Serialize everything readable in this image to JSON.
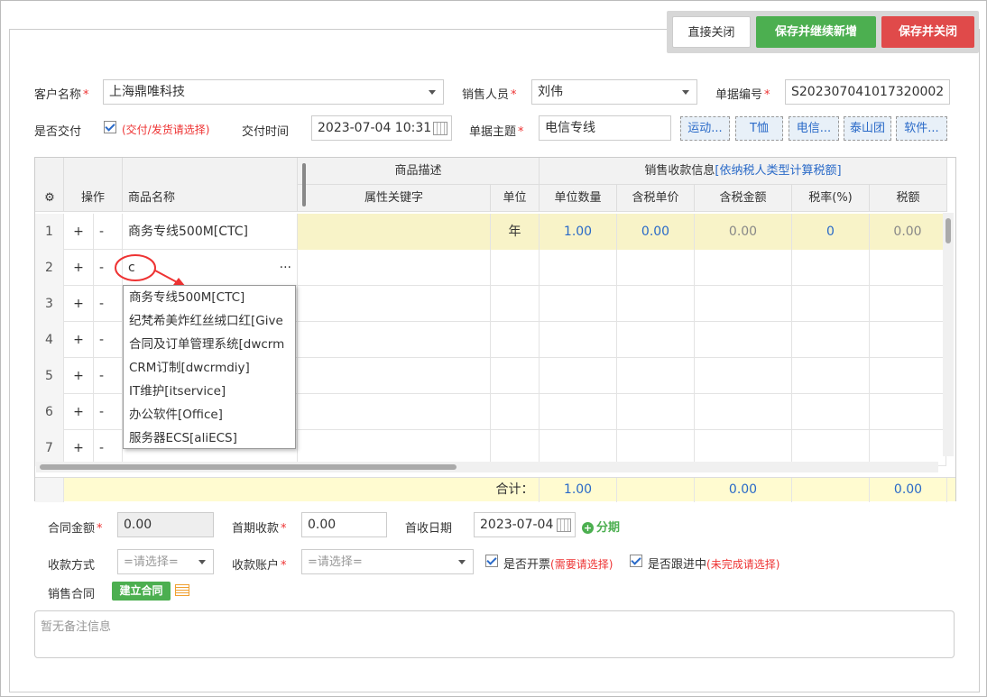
{
  "toolbar": {
    "close_label": "直接关闭",
    "save_new_label": "保存并继续新增",
    "save_close_label": "保存并关闭"
  },
  "form": {
    "customer_label": "客户名称",
    "customer_value": "上海鼎唯科技",
    "sales_label": "销售人员",
    "sales_value": "刘伟",
    "docno_label": "单据编号",
    "docno_value": "S202307041017320002",
    "delivered_label": "是否交付",
    "delivered_hint": "(交付/发货请选择)",
    "delivery_time_label": "交付时间",
    "delivery_time_value": "2023-07-04 10:31",
    "subject_label": "单据主题",
    "subject_value": "电信专线",
    "tags": [
      "运动...",
      "T恤",
      "电信...",
      "泰山团",
      "软件..."
    ]
  },
  "grid": {
    "group_desc": "商品描述",
    "group_sales": "销售收款信息",
    "group_sales_link": "[依纳税人类型计算税额]",
    "columns": [
      "操作",
      "商品名称",
      "属性关键字",
      "单位",
      "单位数量",
      "含税单价",
      "含税金额",
      "税率(%)",
      "税额"
    ],
    "rows": [
      {
        "no": "1",
        "add": "+",
        "del": "-",
        "name": "商务专线500M[CTC]",
        "unit": "年",
        "qty": "1.00",
        "price": "0.00",
        "amount": "0.00",
        "rate": "0",
        "tax": "0.00"
      },
      {
        "no": "2",
        "add": "+",
        "del": "-",
        "name": "c",
        "more": "···"
      },
      {
        "no": "3",
        "add": "+",
        "del": "-"
      },
      {
        "no": "4",
        "add": "+",
        "del": "-"
      },
      {
        "no": "5",
        "add": "+",
        "del": "-"
      },
      {
        "no": "6",
        "add": "+",
        "del": "-"
      },
      {
        "no": "7",
        "add": "+",
        "del": "-"
      }
    ],
    "footer": {
      "label": "合计：",
      "qty": "1.00",
      "amount": "0.00",
      "tax": "0.00"
    }
  },
  "dropdown": [
    "商务专线500M[CTC]",
    "纪梵希美炸红丝绒口红[Give",
    "合同及订单管理系统[dwcrm",
    "CRM订制[dwcrmdiy]",
    "IT维护[itservice]",
    "办公软件[Office]",
    "服务器ECS[aliECS]"
  ],
  "payment": {
    "contract_amount_label": "合同金额",
    "contract_amount_value": "0.00",
    "first_payment_label": "首期收款",
    "first_payment_value": "0.00",
    "first_date_label": "首收日期",
    "first_date_value": "2023-07-04",
    "installment_label": "分期",
    "method_label": "收款方式",
    "method_placeholder": "=请选择=",
    "account_label": "收款账户",
    "account_placeholder": "=请选择=",
    "invoice_label": "是否开票",
    "invoice_hint": "(需要请选择)",
    "follow_label": "是否跟进中",
    "follow_hint": "(未完成请选择)",
    "contract_label": "销售合同",
    "create_contract_label": "建立合同",
    "memo_placeholder": "暂无备注信息"
  },
  "colors": {
    "green": "#4caf50",
    "red": "#e04a4a",
    "blue": "#2a6ac8",
    "yellow": "#fffbd0"
  }
}
